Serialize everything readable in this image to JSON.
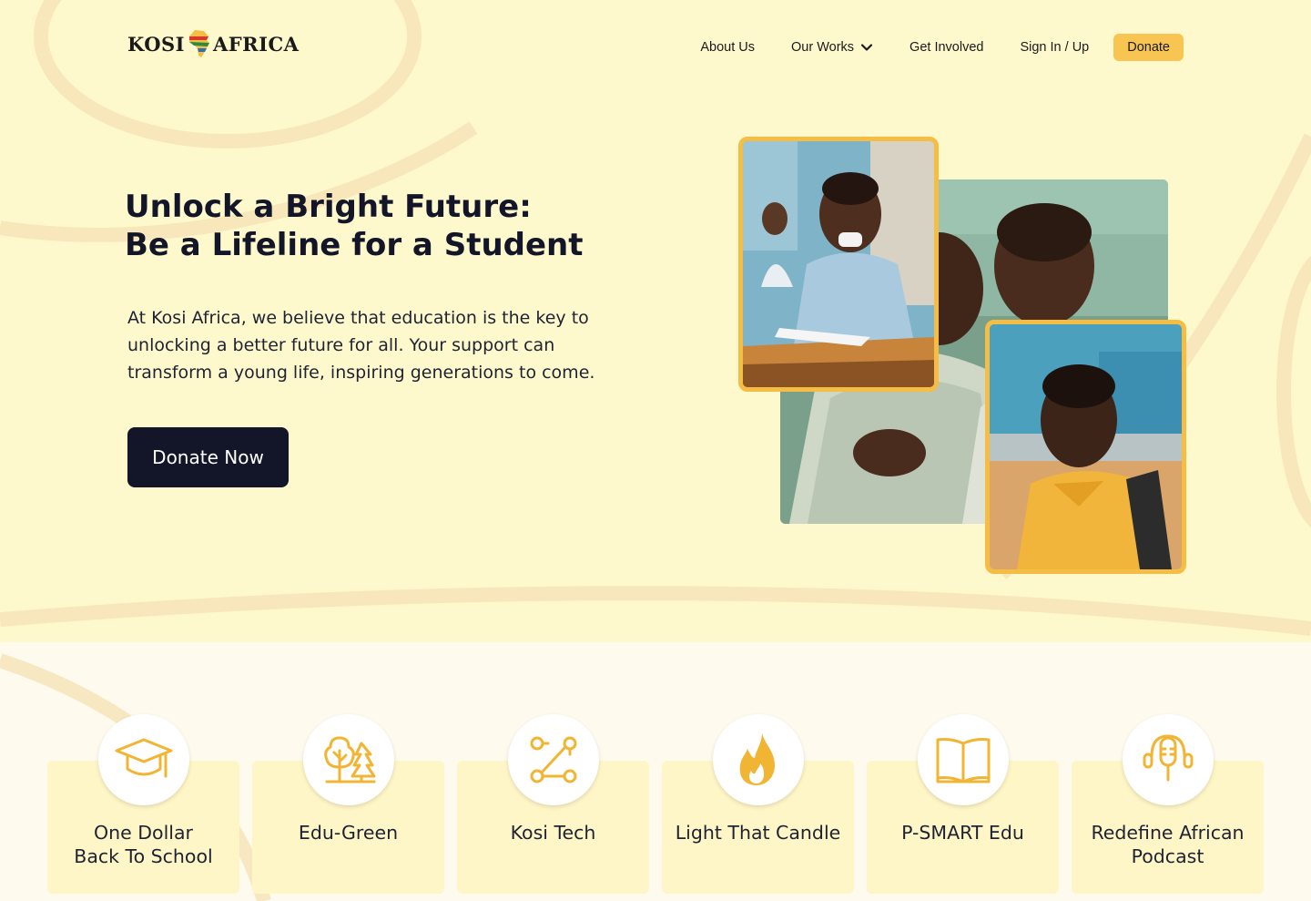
{
  "brand": {
    "logo_left": "KOSI",
    "logo_right": "AFRICA",
    "accent": "#f8c553",
    "dark": "#131629",
    "hero_bg": "#fef9cd"
  },
  "nav": {
    "items": [
      {
        "label": "About Us"
      },
      {
        "label": "Our Works",
        "icon": "chevron-down-icon"
      },
      {
        "label": "Get Involved"
      },
      {
        "label": "Sign In / Up"
      }
    ],
    "donate_label": "Donate"
  },
  "hero": {
    "title_line1": "Unlock a Bright Future:",
    "title_line2": "Be a Lifeline for a Student",
    "description_lines": [
      "At Kosi Africa, we believe that education is the key to",
      "unlocking a better future for all. Your support can",
      "transform a young life, inspiring generations to come."
    ],
    "cta_label": "Donate Now"
  },
  "programs": [
    {
      "lines": [
        "One Dollar",
        "Back To School"
      ],
      "icon": "graduation-cap-icon"
    },
    {
      "lines": [
        "Edu-Green"
      ],
      "icon": "trees-icon"
    },
    {
      "lines": [
        "Kosi Tech"
      ],
      "icon": "route-nodes-icon"
    },
    {
      "lines": [
        "Light That Candle"
      ],
      "icon": "flame-icon"
    },
    {
      "lines": [
        "P-SMART Edu"
      ],
      "icon": "open-book-icon"
    },
    {
      "lines": [
        "Redefine African",
        "Podcast"
      ],
      "icon": "podcast-mic-icon"
    }
  ]
}
